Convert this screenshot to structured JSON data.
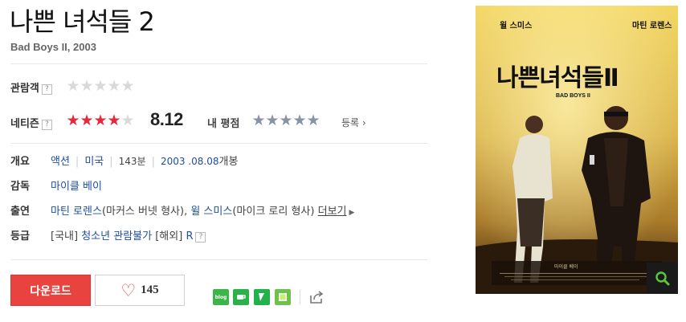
{
  "movie": {
    "title": "나쁜 녀석들 2",
    "original_title": "Bad Boys II, 2003"
  },
  "ratings": {
    "audience_label": "관람객",
    "audience_stars": 0,
    "netizen_label": "네티즌",
    "netizen_stars": 4,
    "netizen_score": "8.12",
    "my_rating_label": "내 평점",
    "register_label": "등록",
    "help_icon": "?"
  },
  "info": {
    "overview_label": "개요",
    "genre": "액션",
    "country": "미국",
    "runtime": "143분",
    "release": "2003 .08.08",
    "release_suffix": "개봉",
    "director_label": "감독",
    "director": "마이클 베이",
    "cast_label": "출연",
    "cast1": "마틴 로렌스",
    "cast1_role": "(마커스 버넷 형사), ",
    "cast2": "윌 스미스",
    "cast2_role": "(마이크 로리 형사)",
    "more_label": "더보기",
    "grade_label": "등급",
    "grade_domestic_prefix": "[국내]",
    "grade_domestic": "청소년 관람불가",
    "grade_overseas_prefix": "[해외]",
    "grade_overseas": "R"
  },
  "actions": {
    "download_label": "다운로드",
    "like_count": "145"
  },
  "share": {
    "icons": [
      "blog-icon",
      "cafe-icon",
      "band-icon",
      "memo-icon",
      "share-out-icon"
    ],
    "blog_text": "blog"
  },
  "poster": {
    "actor_left": "윌 스미스",
    "actor_right": "마틴 로렌스",
    "title": "나쁜녀석들Ⅱ",
    "subtitle": "BAD BOYS II",
    "credits": "마이클 베이"
  },
  "colors": {
    "accent_red": "#e9433f",
    "star_red": "#e8283c",
    "link_blue": "#1f4fa0"
  }
}
